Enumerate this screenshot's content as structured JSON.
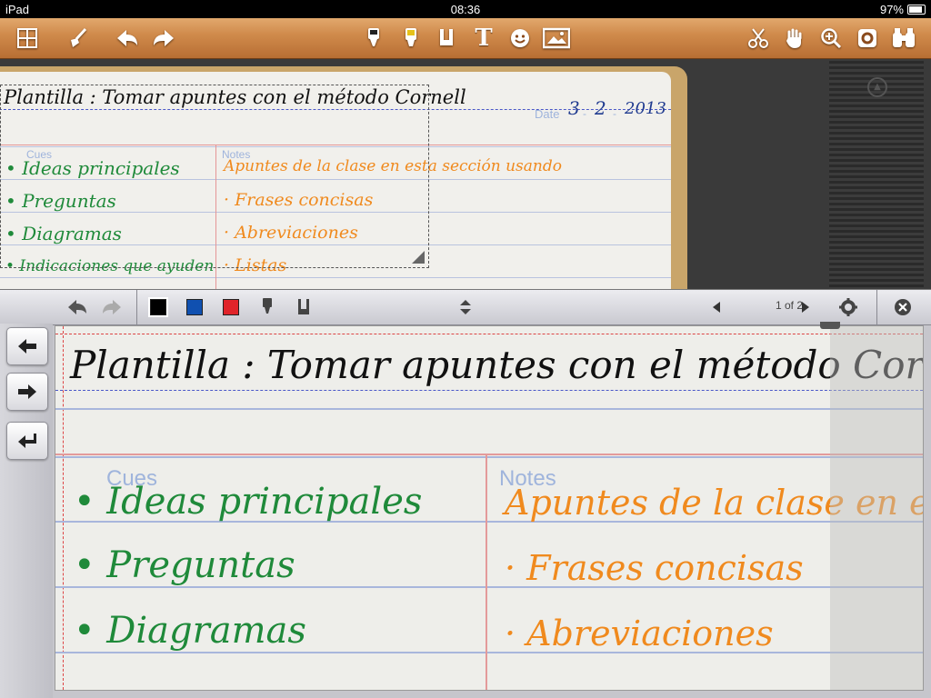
{
  "status": {
    "carrier": "iPad",
    "time": "08:36",
    "battery": "97%"
  },
  "toolbar": {
    "icons": [
      "grid-icon",
      "broom-icon",
      "undo-icon",
      "redo-icon",
      "pen-icon",
      "highlighter-icon",
      "eraser-icon",
      "text-icon",
      "emoji-icon",
      "image-icon",
      "scissors-icon",
      "hand-icon",
      "zoom-in-icon",
      "settings-icon",
      "binoculars-icon"
    ],
    "text_tool": "T"
  },
  "note": {
    "title": "Plantilla : Tomar apuntes con el método Cornell",
    "date_label": "Date",
    "date_day": "3",
    "date_month": "2",
    "date_year": "2013",
    "cues_label": "Cues",
    "notes_label": "Notes",
    "cues": [
      "• Ideas principales",
      "• Preguntas",
      "• Diagramas",
      "• Indicaciones que ayuden"
    ],
    "notes": [
      "Apuntes de la clase en esta sección usando",
      "· Frases concisas",
      "· Abreviaciones",
      "· Listas"
    ]
  },
  "zoom_title": "Plantilla : Tomar apuntes con el método Cornell",
  "zoom_cues": [
    "• Ideas principales",
    "• Preguntas",
    "• Diagramas"
  ],
  "zoom_notes": [
    "Apuntes de la clase en est",
    "· Frases concisas",
    "· Abreviaciones"
  ],
  "pager": {
    "text": "1 of 2"
  },
  "colors": {
    "ink_green": "#1f8a3a",
    "ink_orange": "#f08a1e",
    "ink_black": "#111111",
    "ink_blue": "#1f3a8f",
    "swatch_blue": "#1050b0",
    "swatch_red": "#e0242a",
    "wood": "#c27a3c"
  }
}
